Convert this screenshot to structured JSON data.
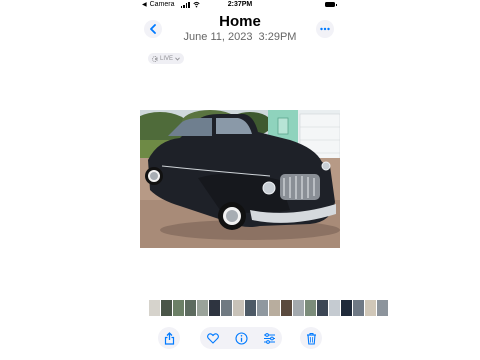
{
  "status_bar": {
    "back_app_label": "Camera",
    "time": "2:37PM"
  },
  "nav": {
    "title": "Home",
    "subtitle": "June 11, 2023  3:29PM"
  },
  "live_badge": {
    "label": "LIVE"
  },
  "photo": {
    "subject": "black vintage coupe car"
  },
  "thumbnails": {
    "colors": [
      "#d6d3cc",
      "#4a5548",
      "#6c8066",
      "#5d6b5f",
      "#9aa39a",
      "#2e3440",
      "#707a82",
      "#c8c2b8",
      "#4d5a66",
      "#8f989f",
      "#b8ad9e",
      "#5a4a3e",
      "#a3a9ae",
      "#7b8c7a",
      "#3b4654",
      "#c5cbd1",
      "#1f2a3a",
      "#6f7985",
      "#d0c7b8",
      "#8c949c"
    ]
  },
  "toolbar": {
    "icons": [
      "share-icon",
      "heart-icon",
      "info-icon",
      "adjust-icon",
      "trash-icon"
    ],
    "accent": "#007aff"
  }
}
